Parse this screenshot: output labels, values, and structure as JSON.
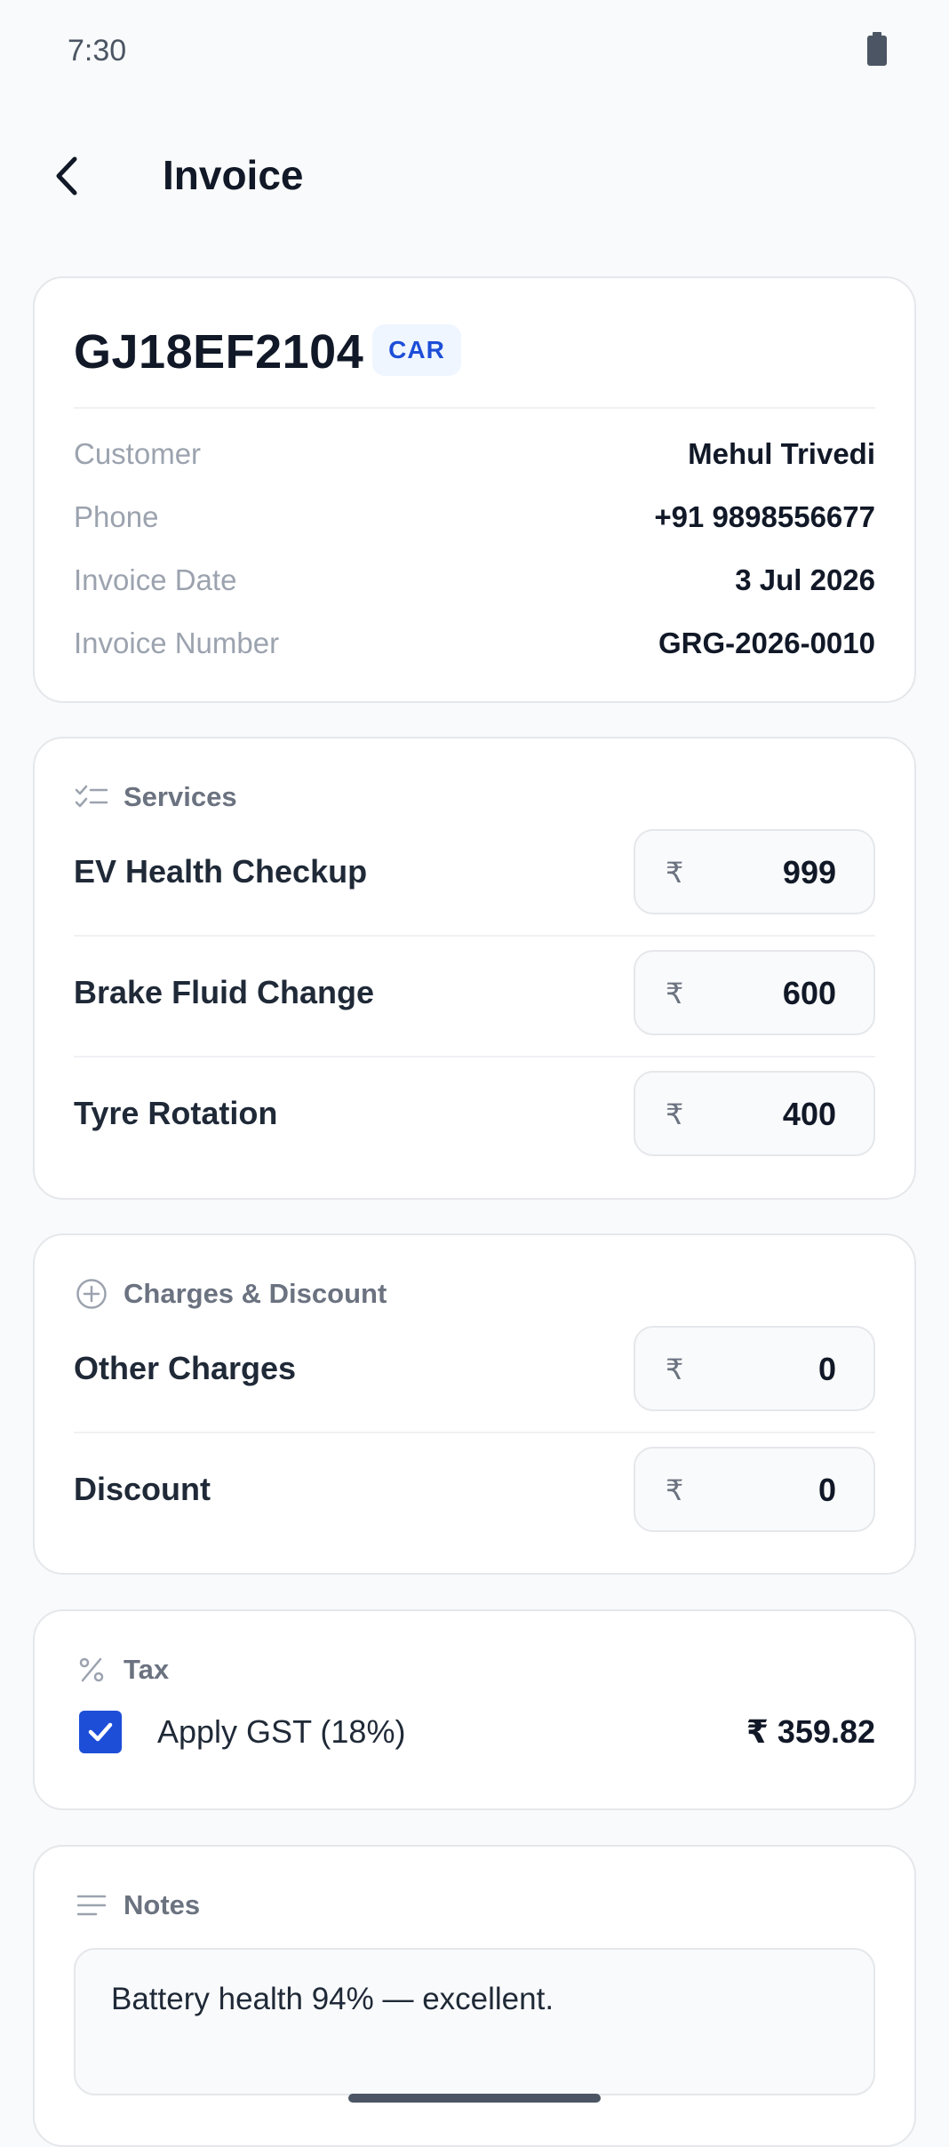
{
  "status_bar": {
    "time": "7:30"
  },
  "header": {
    "title": "Invoice"
  },
  "vehicle": {
    "plate": "GJ18EF2104",
    "type_badge": "CAR",
    "rows": [
      {
        "label": "Customer",
        "value": "Mehul Trivedi"
      },
      {
        "label": "Phone",
        "value": "+91 9898556677"
      },
      {
        "label": "Invoice Date",
        "value": "3 Jul 2026"
      },
      {
        "label": "Invoice Number",
        "value": "GRG-2026-0010"
      }
    ]
  },
  "services": {
    "title": "Services",
    "currency": "₹",
    "items": [
      {
        "label": "EV Health Checkup",
        "amount": "999"
      },
      {
        "label": "Brake Fluid Change",
        "amount": "600"
      },
      {
        "label": "Tyre Rotation",
        "amount": "400"
      }
    ]
  },
  "charges": {
    "title": "Charges & Discount",
    "currency": "₹",
    "items": [
      {
        "label": "Other Charges",
        "amount": "0"
      },
      {
        "label": "Discount",
        "amount": "0"
      }
    ]
  },
  "tax": {
    "title": "Tax",
    "gst_label": "Apply GST (18%)",
    "gst_checked": true,
    "gst_amount": "₹ 359.82"
  },
  "notes": {
    "title": "Notes",
    "text": "Battery health 94% — excellent."
  },
  "colors": {
    "accent": "#1d4ed8",
    "badge_bg": "#eff6ff",
    "text_primary": "#111827",
    "text_muted": "#9ca3af"
  }
}
